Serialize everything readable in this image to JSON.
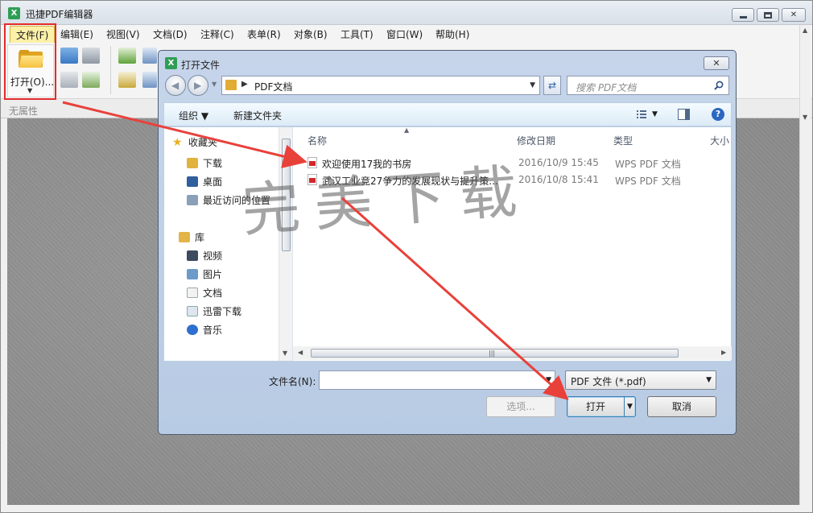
{
  "app": {
    "title": "迅捷PDF编辑器",
    "icon_glyph": "X"
  },
  "menu": {
    "items": [
      "文件(F)",
      "编辑(E)",
      "视图(V)",
      "文档(D)",
      "注释(C)",
      "表单(R)",
      "对象(B)",
      "工具(T)",
      "窗口(W)",
      "帮助(H)"
    ]
  },
  "toolbar": {
    "open_label": "打开(O)...",
    "open_caret": "▼"
  },
  "properties": {
    "label": "无属性"
  },
  "dialog": {
    "title": "打开文件",
    "close_glyph": "✕",
    "address": {
      "path": "PDF文档",
      "separator": "▶",
      "caret": "▼"
    },
    "search_placeholder": "搜索 PDF文档",
    "commands": {
      "organize": "组织 ▼",
      "new_folder": "新建文件夹",
      "view_caret": "▼",
      "help_glyph": "?"
    },
    "nav": {
      "favorites": "收藏夹",
      "downloads": "下载",
      "desktop": "桌面",
      "recent": "最近访问的位置",
      "library": "库",
      "videos": "视频",
      "pictures": "图片",
      "documents": "文档",
      "thunder": "迅雷下载",
      "music": "音乐"
    },
    "columns": {
      "name": "名称",
      "date": "修改日期",
      "type": "类型",
      "size": "大小"
    },
    "files": [
      {
        "name": "欢迎使用17我的书房",
        "date": "2016/10/9 15:45",
        "type": "WPS PDF 文档"
      },
      {
        "name": "武汉工业竞27争力的发展现状与提升策...",
        "date": "2016/10/8 15:41",
        "type": "WPS PDF 文档"
      }
    ],
    "filename_label": "文件名(N):",
    "filename_value": "",
    "filetype": "PDF 文件 (*.pdf)",
    "buttons": {
      "options": "选项...",
      "open": "打开",
      "cancel": "取消"
    }
  },
  "watermark": "完美下载",
  "colors": {
    "highlight_box": "#e42b2b",
    "arrow": "#e8413a",
    "pdf_red": "#d4262a"
  }
}
